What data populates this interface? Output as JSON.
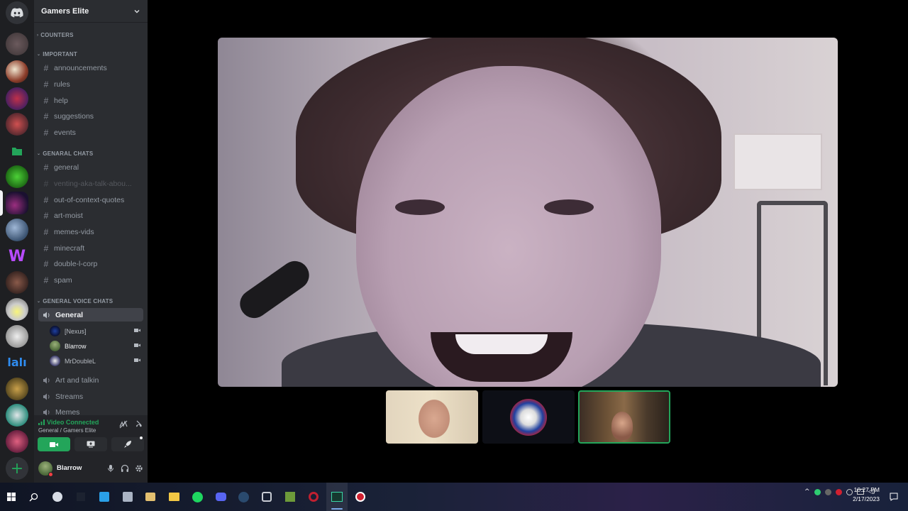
{
  "server": {
    "name": "Gamers Elite"
  },
  "categories": {
    "counters": "COUNTERS",
    "important": "IMPORTANT",
    "general_chats": "GENARAL CHATS",
    "general_voice": "GENERAL VOICE CHATS"
  },
  "important_channels": [
    "announcements",
    "rules",
    "help",
    "suggestions",
    "events"
  ],
  "chat_channels": [
    "general",
    "venting-aka-talk-abou...",
    "out-of-context-quotes",
    "art-moist",
    "memes-vids",
    "minecraft",
    "double-l-corp",
    "spam"
  ],
  "voice": {
    "active_channel": "General",
    "users": [
      "[Nexus]",
      "Blarrow",
      "MrDoubleL"
    ],
    "other_channels": [
      "Art and talkin",
      "Streams",
      "Memes"
    ]
  },
  "voice_panel": {
    "status": "Video Connected",
    "location": "General / Gamers Elite"
  },
  "user": {
    "name": "Blarrow"
  },
  "taskbar": {
    "time": "10:27 PM",
    "date": "2/17/2023"
  },
  "colors": {
    "green": "#23a55a",
    "sidebar": "#2b2d31",
    "rail": "#1e1f22"
  }
}
